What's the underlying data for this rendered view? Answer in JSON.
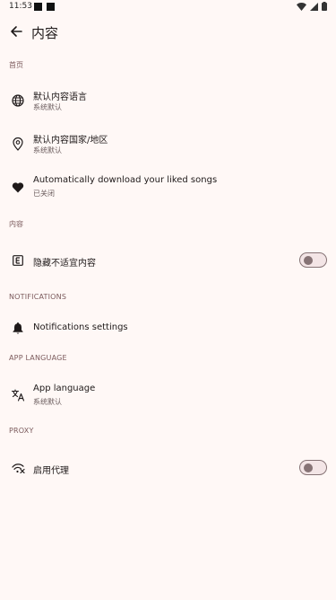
{
  "status": {
    "time": "11:53"
  },
  "header": {
    "title": "内容"
  },
  "sections": {
    "homepage": {
      "label": "首页"
    },
    "content": {
      "label": "内容"
    },
    "notifications": {
      "label": "NOTIFICATIONS"
    },
    "app_language": {
      "label": "APP LANGUAGE"
    },
    "proxy": {
      "label": "PROXY"
    }
  },
  "items": {
    "default_content_language": {
      "title": "默认内容语言",
      "subtitle": "系统默认"
    },
    "default_content_country": {
      "title": "默认内容国家/地区",
      "subtitle": "系统默认"
    },
    "auto_download_liked": {
      "title": "Automatically download your liked songs",
      "subtitle": "已关闭"
    },
    "hide_explicit": {
      "title": "隐藏不适宜内容",
      "toggle_on": false
    },
    "notifications_settings": {
      "title": "Notifications settings"
    },
    "app_language": {
      "title": "App language",
      "subtitle": "系统默认"
    },
    "enable_proxy": {
      "title": "启用代理",
      "toggle_on": false
    }
  },
  "icons": {
    "back": "arrow-left-icon",
    "language": "globe-icon",
    "location": "location-pin-icon",
    "liked": "heart-icon",
    "explicit": "explicit-icon",
    "notifications": "bell-icon",
    "translate": "translate-icon",
    "proxy": "proxy-icon"
  },
  "colors": {
    "background": "#fff8f6",
    "section_header": "#7b5a5c",
    "toggle_track": "#f3e5e6",
    "toggle_outline": "#867375"
  }
}
